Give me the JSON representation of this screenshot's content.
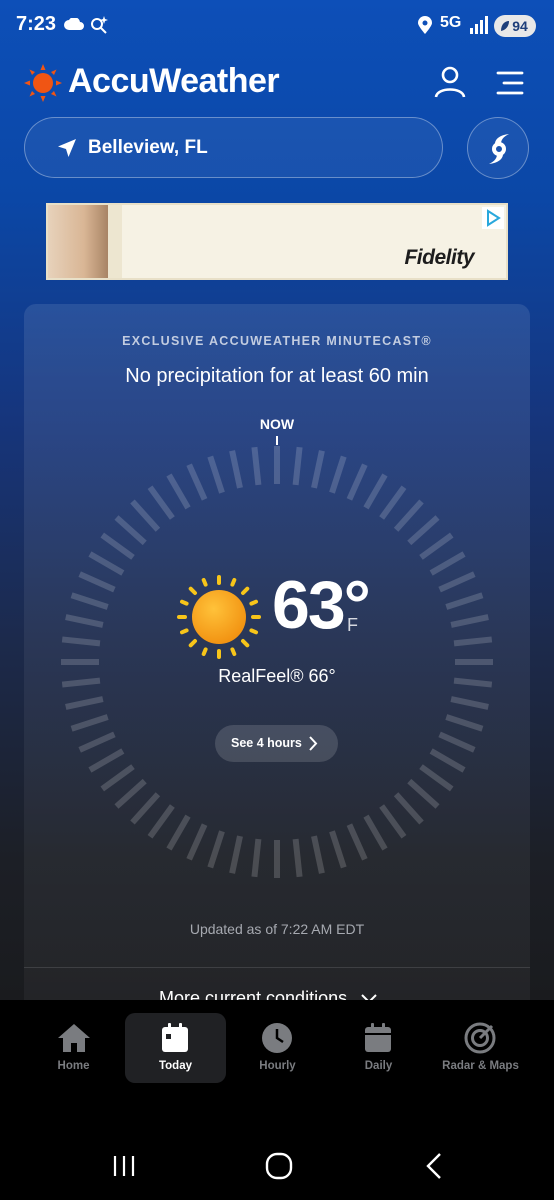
{
  "status_bar": {
    "time": "7:23",
    "network": "5G",
    "battery": "94",
    "icons": [
      "cloud-icon",
      "search-sparkle-icon",
      "location-icon",
      "signal-icon",
      "battery-saver-icon"
    ]
  },
  "header": {
    "brand": "AccuWeather",
    "brand_color": "#f05514",
    "icons": [
      "sun-logo-icon",
      "account-icon",
      "menu-icon"
    ]
  },
  "location": {
    "name": "Belleview, FL",
    "icons": [
      "location-arrow-icon",
      "hurricane-icon"
    ]
  },
  "ad": {
    "brand": "Fidelity",
    "icons": [
      "ad-choices-icon"
    ]
  },
  "minutecast": {
    "eyebrow": "EXCLUSIVE ACCUWEATHER MINUTECAST®",
    "headline": "No precipitation for at least 60 min",
    "now_label": "NOW",
    "temperature": "63°",
    "unit": "F",
    "realfeel": "RealFeel® 66°",
    "see_hours_label": "See 4 hours",
    "updated": "Updated as of 7:22 AM EDT",
    "more_label": "More current conditions",
    "condition_icon": "sun-icon"
  },
  "bottom_nav": {
    "items": [
      {
        "label": "Home",
        "icon": "home-icon",
        "active": false
      },
      {
        "label": "Today",
        "icon": "calendar-today-icon",
        "active": true
      },
      {
        "label": "Hourly",
        "icon": "clock-icon",
        "active": false
      },
      {
        "label": "Daily",
        "icon": "calendar-icon",
        "active": false
      },
      {
        "label": "Radar & Maps",
        "icon": "radar-icon",
        "active": false
      }
    ]
  },
  "system_nav": {
    "icons": [
      "recents-icon",
      "home-circle-icon",
      "back-icon"
    ]
  },
  "colors": {
    "background_top": "#0d4fb8",
    "background_bottom": "#1a1b1e",
    "sun": "#f7a51a",
    "ad_background": "#f6f2e4"
  }
}
